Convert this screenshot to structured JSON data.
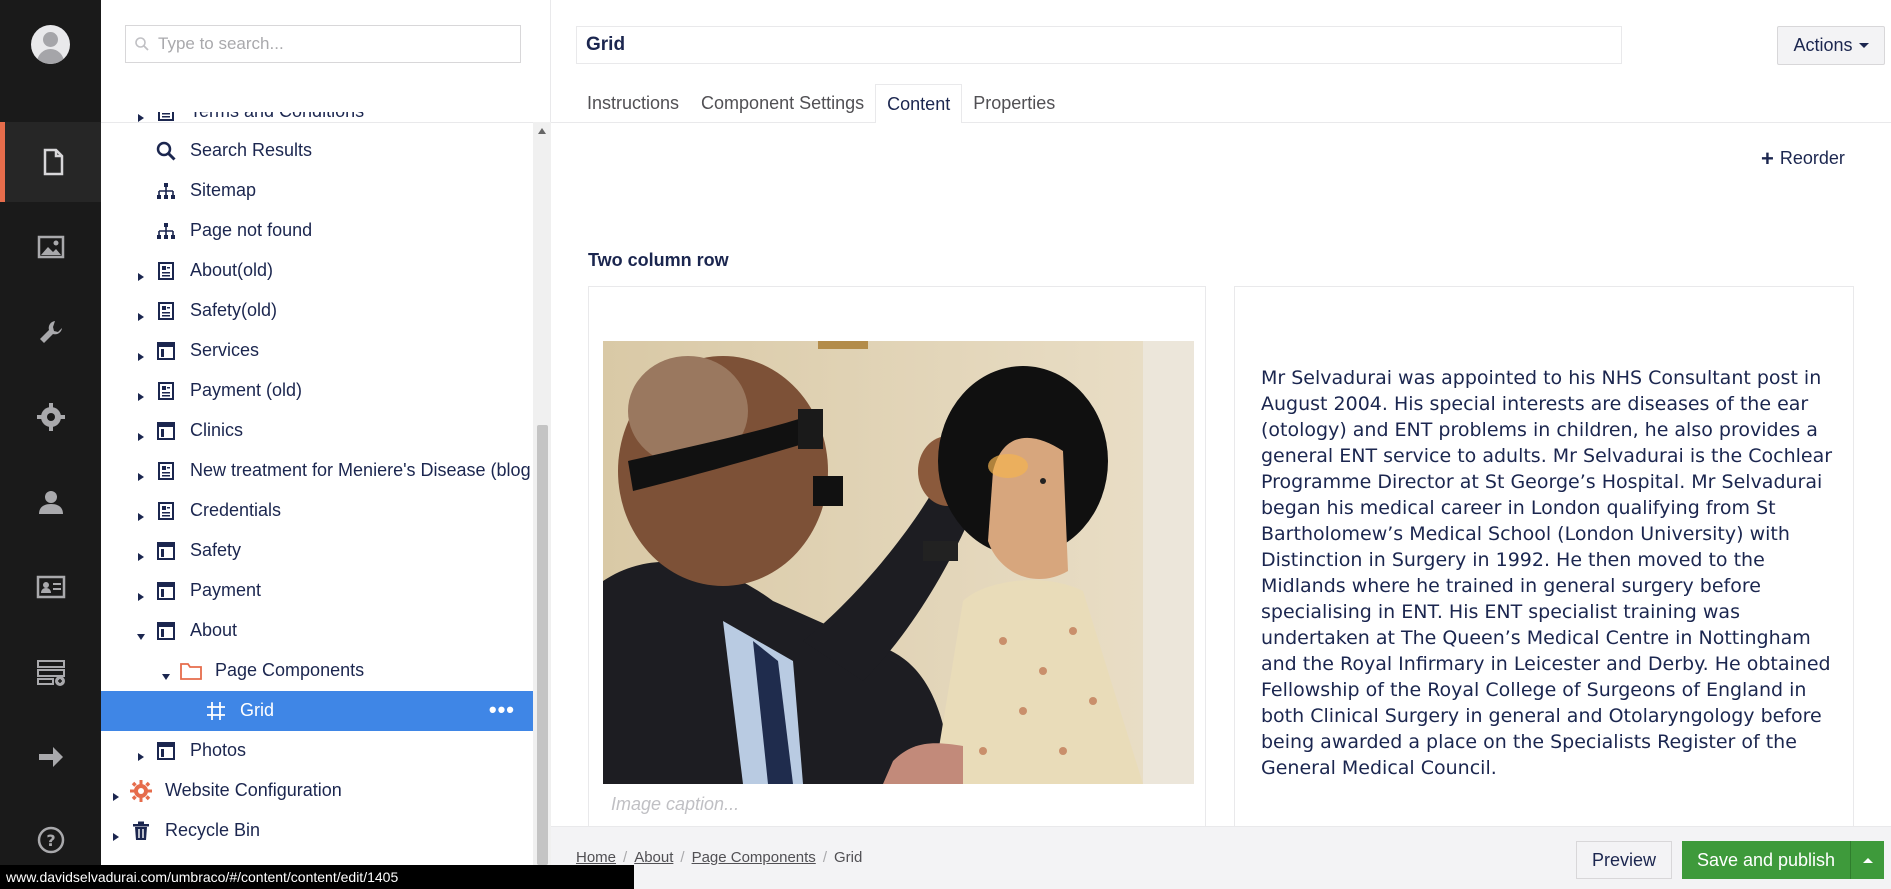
{
  "search": {
    "placeholder": "Type to search..."
  },
  "rail": {
    "items": [
      {
        "name": "content-section-icon",
        "active": true
      },
      {
        "name": "media-section-icon"
      },
      {
        "name": "settings-section-icon"
      },
      {
        "name": "developer-section-icon"
      },
      {
        "name": "users-section-icon"
      },
      {
        "name": "members-section-icon"
      },
      {
        "name": "forms-section-icon"
      },
      {
        "name": "redirect-section-icon"
      },
      {
        "name": "help-icon"
      }
    ]
  },
  "tree": {
    "nodes": [
      {
        "label": "Terms and Conditions",
        "icon": "document-icon",
        "caret": "right"
      },
      {
        "label": "Search Results",
        "icon": "search-icon",
        "caret": ""
      },
      {
        "label": "Sitemap",
        "icon": "sitemap-icon",
        "caret": ""
      },
      {
        "label": "Page not found",
        "icon": "sitemap-icon",
        "caret": ""
      },
      {
        "label": "About(old)",
        "icon": "document-icon",
        "caret": "right"
      },
      {
        "label": "Safety(old)",
        "icon": "document-icon",
        "caret": "right"
      },
      {
        "label": "Services",
        "icon": "layout-icon",
        "caret": "right"
      },
      {
        "label": "Payment (old)",
        "icon": "document-icon",
        "caret": "right"
      },
      {
        "label": "Clinics",
        "icon": "layout-icon",
        "caret": "right"
      },
      {
        "label": "New treatment for Meniere's Disease (blog",
        "icon": "document-icon",
        "caret": "right"
      },
      {
        "label": "Credentials",
        "icon": "document-icon",
        "caret": "right"
      },
      {
        "label": "Safety",
        "icon": "layout-icon",
        "caret": "right"
      },
      {
        "label": "Payment",
        "icon": "layout-icon",
        "caret": "right"
      },
      {
        "label": "About",
        "icon": "layout-icon",
        "caret": "down"
      },
      {
        "label": "Page Components",
        "icon": "folder-icon",
        "caret": "down"
      },
      {
        "label": "Grid",
        "icon": "grid-icon",
        "caret": "",
        "selected": true
      },
      {
        "label": "Photos",
        "icon": "layout-icon",
        "caret": "right"
      },
      {
        "label": "Website Configuration",
        "icon": "gear-icon",
        "caret": "right"
      },
      {
        "label": "Recycle Bin",
        "icon": "trash-icon",
        "caret": "right"
      }
    ],
    "selected_more": "•••"
  },
  "status_url": "www.davidselvadurai.com/umbraco/#/content/content/edit/1405",
  "editor": {
    "title": "Grid",
    "actions_label": "Actions",
    "tabs": [
      {
        "label": "Instructions"
      },
      {
        "label": "Component Settings"
      },
      {
        "label": "Content",
        "active": true
      },
      {
        "label": "Properties"
      }
    ],
    "reorder_label": "Reorder",
    "row_title": "Two column row",
    "image_caption_placeholder": "Image caption...",
    "bio": "Mr Selvadurai was appointed to his NHS Consultant post in August 2004. His special interests are diseases of the ear (otology) and ENT problems in children, he also provides a general ENT service to adults. Mr Selvadurai is the Cochlear Programme Director at St George’s Hospital. Mr Selvadurai began his medical career in London qualifying from St Bartholomew’s Medical School (London University) with Distinction in Surgery in 1992. He then moved to the Midlands where he trained in general surgery before specialising in ENT. His ENT specialist training was undertaken at The Queen’s Medical Centre in Nottingham and the Royal Infirmary in Leicester and Derby. He obtained Fellowship of the Royal College of Surgeons of England in both Clinical Surgery in general and Otolaryngology before being awarded a place on the Specialists Register of the General Medical Council."
  },
  "footer": {
    "breadcrumbs": [
      "Home",
      "About",
      "Page Components",
      "Grid"
    ],
    "preview_label": "Preview",
    "publish_label": "Save and publish"
  },
  "colors": {
    "rail_bg": "#1a1a1a",
    "accent_orange": "#e66c4b",
    "selected_blue": "#3f86e6",
    "publish_green": "#3e9a3b",
    "text_navy": "#1b264f"
  }
}
